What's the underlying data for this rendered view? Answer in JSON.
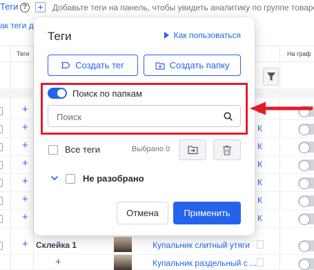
{
  "page": {
    "tags_word": "Теги",
    "hint": "Добавьте теги на панель, чтобы увидеть аналитику по группе товаров",
    "add_tags_link": "ак теги д",
    "col_tags": "Теги",
    "col_on_graph": "На граф"
  },
  "rows": {
    "tag_name": "Склейка 1",
    "product_1": "Купальник слитный утяги",
    "product_2": "Купальник раздельный с ..."
  },
  "modal": {
    "title": "Теги",
    "how_to": "Как пользоваться",
    "create_tag": "Создать тег",
    "create_folder": "Создать папку",
    "folder_search_label": "Поиск по папкам",
    "folder_search_on": true,
    "search_placeholder": "Поиск",
    "all_tags": "Все теги",
    "selected": "Выбрано 0",
    "unsorted": "Не разобрано",
    "cancel": "Отмена",
    "apply": "Применить"
  },
  "colors": {
    "accent": "#2563eb",
    "highlight": "#e11d2a"
  },
  "icons": [
    "help-icon",
    "plus-icon",
    "filter-icon",
    "play-icon",
    "tag-icon",
    "folder-plus-icon",
    "search-icon",
    "folder-move-icon",
    "trash-icon",
    "chevron-down-icon",
    "arrow-left-icon"
  ]
}
